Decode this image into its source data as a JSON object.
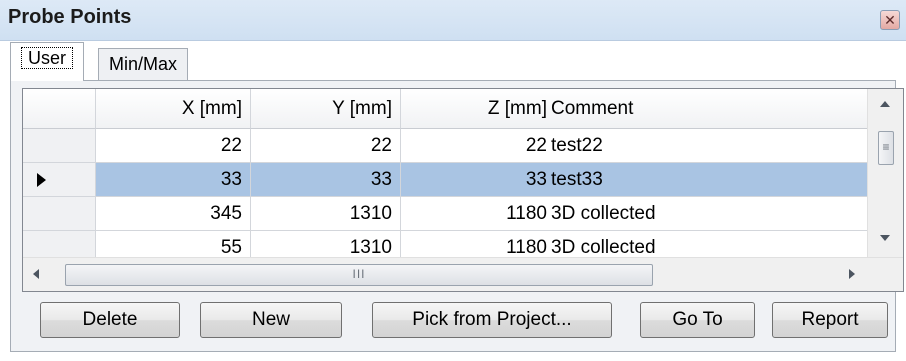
{
  "window": {
    "title": "Probe Points",
    "close_glyph": "✕"
  },
  "tabs": [
    {
      "label": "User",
      "active": true
    },
    {
      "label": "Min/Max",
      "active": false
    }
  ],
  "grid": {
    "columns": [
      "",
      "X [mm]",
      "Y [mm]",
      "Z [mm]",
      "Comment"
    ],
    "rows": [
      {
        "x": "22",
        "y": "22",
        "z": "22",
        "comment": "test22",
        "selected": false
      },
      {
        "x": "33",
        "y": "33",
        "z": "33",
        "comment": "test33",
        "selected": true
      },
      {
        "x": "345",
        "y": "1310",
        "z": "1180",
        "comment": "3D collected",
        "selected": false
      },
      {
        "x": "55",
        "y": "1310",
        "z": "1180",
        "comment": "3D collected",
        "selected": false
      }
    ],
    "hscroll_grip": "III",
    "vscroll_grip": "≡"
  },
  "buttons": {
    "delete": "Delete",
    "new": "New",
    "pick": "Pick from Project...",
    "goto": "Go To",
    "report": "Report"
  },
  "colors": {
    "selection": "#a9c4e3",
    "titlebar": "#d6e5f5"
  }
}
